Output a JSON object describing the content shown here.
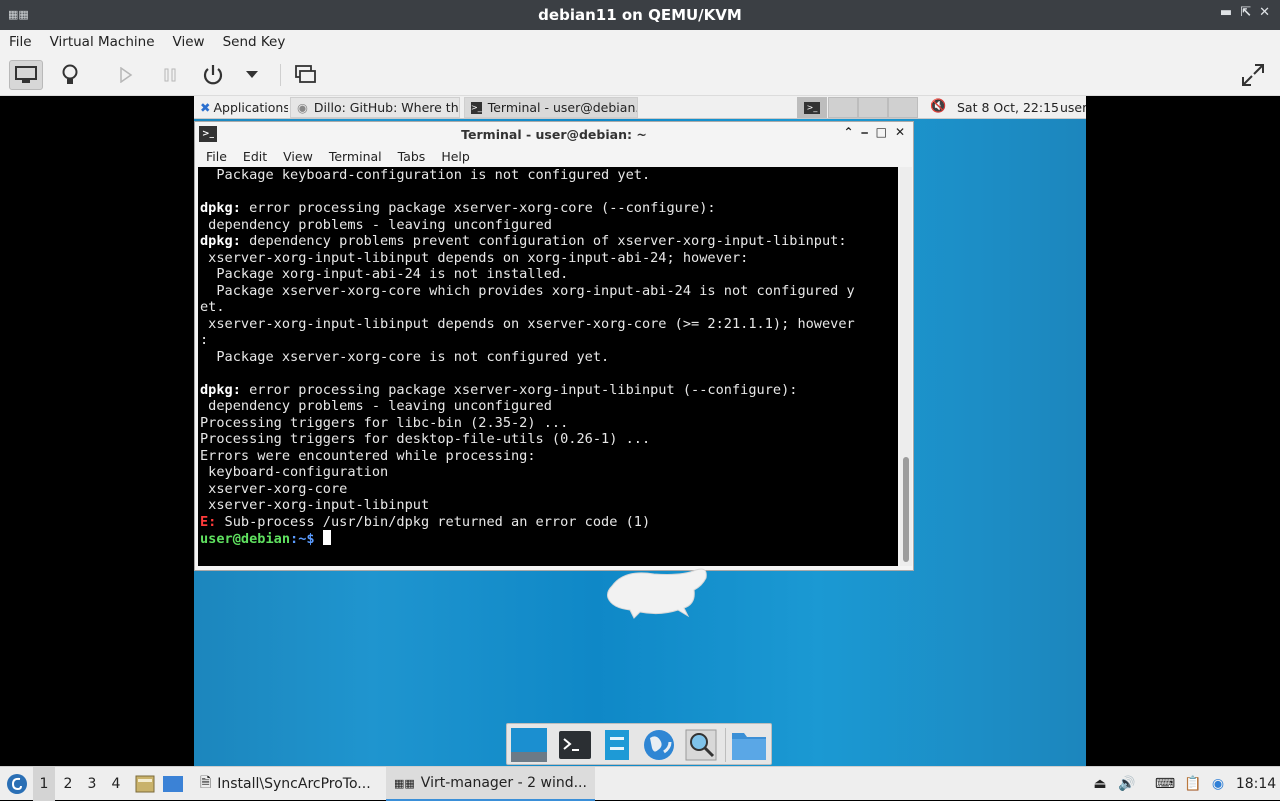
{
  "window": {
    "title": "debian11 on QEMU/KVM"
  },
  "menubar": [
    "File",
    "Virtual Machine",
    "View",
    "Send Key"
  ],
  "toolbar": {
    "icons": [
      "monitor-icon",
      "lightbulb-icon",
      "play-icon",
      "pause-icon",
      "power-icon",
      "dropdown-icon",
      "snapshot-icon",
      "fullscreen-icon"
    ]
  },
  "guest_panel": {
    "apps_label": "Applications",
    "tasks": [
      "Dillo: GitHub: Where th...",
      "Terminal - user@debian..."
    ],
    "clock": "Sat  8 Oct, 22:15",
    "user": "user"
  },
  "terminal": {
    "title": "Terminal - user@debian: ~",
    "menu": [
      "File",
      "Edit",
      "View",
      "Terminal",
      "Tabs",
      "Help"
    ],
    "lines": [
      {
        "t": "  Package keyboard-configuration is not configured yet."
      },
      {
        "t": ""
      },
      {
        "b": "dpkg:",
        "t": " error processing package xserver-xorg-core (--configure):"
      },
      {
        "t": " dependency problems - leaving unconfigured"
      },
      {
        "b": "dpkg:",
        "t": " dependency problems prevent configuration of xserver-xorg-input-libinput:"
      },
      {
        "t": " xserver-xorg-input-libinput depends on xorg-input-abi-24; however:"
      },
      {
        "t": "  Package xorg-input-abi-24 is not installed."
      },
      {
        "t": "  Package xserver-xorg-core which provides xorg-input-abi-24 is not configured y"
      },
      {
        "t": "et."
      },
      {
        "t": " xserver-xorg-input-libinput depends on xserver-xorg-core (>= 2:21.1.1); however"
      },
      {
        "t": ":"
      },
      {
        "t": "  Package xserver-xorg-core is not configured yet."
      },
      {
        "t": ""
      },
      {
        "b": "dpkg:",
        "t": " error processing package xserver-xorg-input-libinput (--configure):"
      },
      {
        "t": " dependency problems - leaving unconfigured"
      },
      {
        "t": "Processing triggers for libc-bin (2.35-2) ..."
      },
      {
        "t": "Processing triggers for desktop-file-utils (0.26-1) ..."
      },
      {
        "t": "Errors were encountered while processing:"
      },
      {
        "t": " keyboard-configuration"
      },
      {
        "t": " xserver-xorg-core"
      },
      {
        "t": " xserver-xorg-input-libinput"
      },
      {
        "e": "E:",
        "t": " Sub-process /usr/bin/dpkg returned an error code (1)"
      }
    ],
    "prompt_user": "user@debian",
    "prompt_path": ":~$ "
  },
  "host_taskbar": {
    "workspaces": [
      "1",
      "2",
      "3",
      "4"
    ],
    "tasks": [
      "Install\\SyncArcProTo...",
      "Virt-manager - 2 wind..."
    ],
    "clock": "18:14"
  }
}
